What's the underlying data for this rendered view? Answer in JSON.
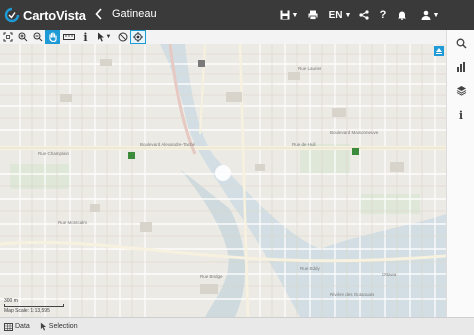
{
  "header": {
    "logo_text": "CartoVista",
    "map_title": "Gatineau",
    "language": "EN"
  },
  "colors": {
    "header_bg": "#3a3a3a",
    "accent": "#1e9bd7",
    "map_bg": "#eceae4"
  },
  "toolbar": {
    "tools": [
      "full-extent",
      "zoom-in",
      "zoom-out",
      "pan",
      "measure",
      "identify",
      "select",
      "clear-selection",
      "locate"
    ],
    "active_tool": "pan"
  },
  "sidebar": {
    "buttons": [
      "search",
      "charts",
      "layers",
      "info"
    ]
  },
  "map": {
    "labels": {
      "boulevard_alexandre_tache": "Boulevard Alexandre-Taché",
      "rue_de_hull": "Rue de Hull",
      "rue_laurier": "Rue Laurier",
      "rue_champlain": "Rue Champlain",
      "rue_montcalm": "Rue Montcalm",
      "boulevard_maisonneuve": "Boulevard Maisonneuve",
      "rue_eddy": "Rue Eddy",
      "ottawa": "Ottawa",
      "rue_bridge": "Rue Bridge",
      "riviere_des_outaouais": "Rivière des Outaouais",
      "scale_label": "300 m",
      "scale_text": "Map Scale: 1:13,595"
    }
  },
  "statusbar": {
    "data_label": "Data",
    "selection_label": "Selection"
  }
}
